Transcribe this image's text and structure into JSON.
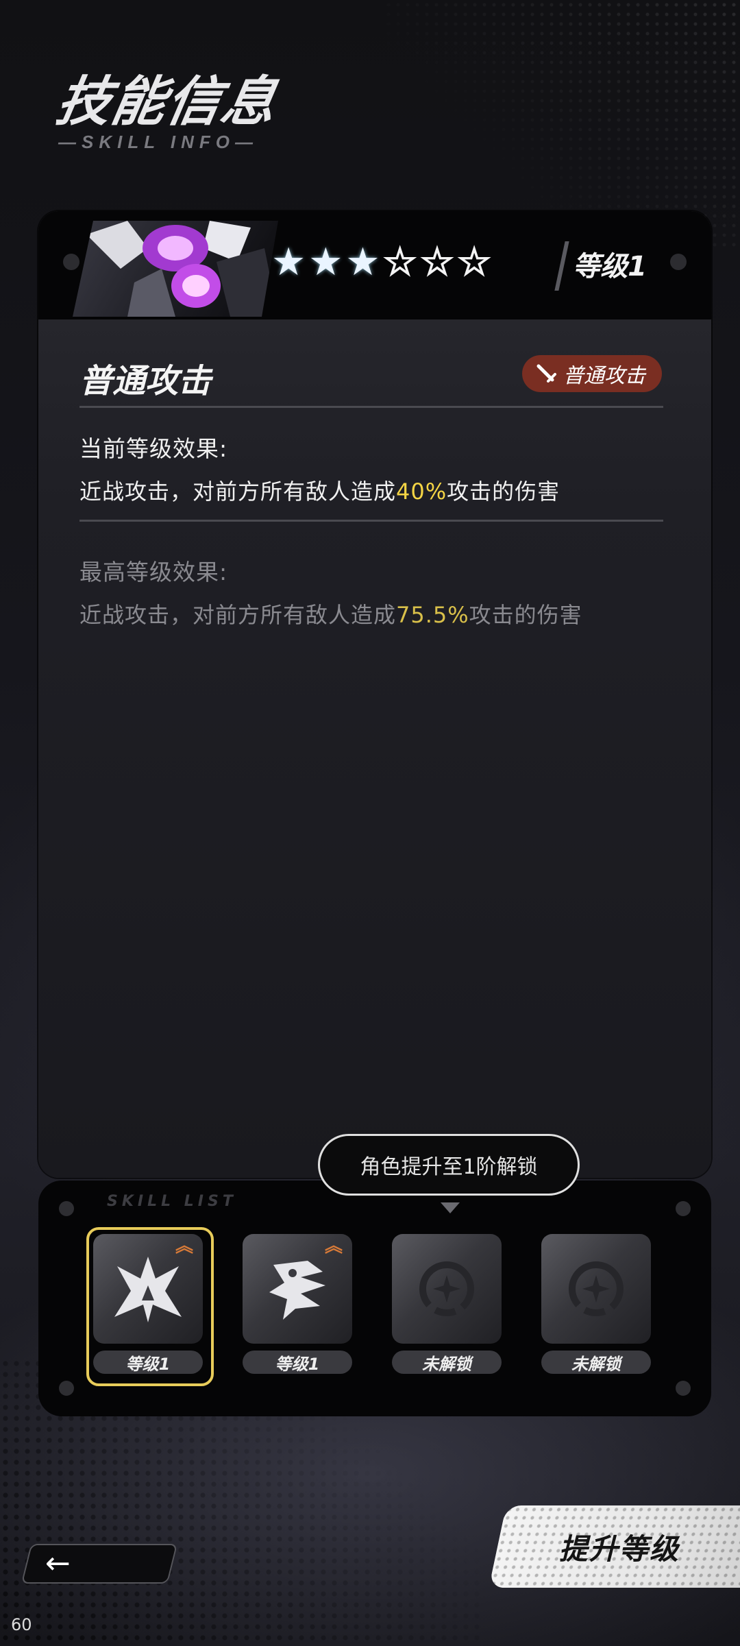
{
  "header": {
    "title": "技能信息",
    "subtitle": "—SKILL INFO—"
  },
  "skill_card": {
    "stars_filled": 3,
    "stars_total": 6,
    "level_label": "等级1",
    "skill_name": "普通攻击",
    "badge_label": "普通攻击",
    "badge_color": "#7a2e22",
    "current_effect": {
      "title": "当前等级效果:",
      "text_before": "近战攻击，对前方所有敌人造成",
      "highlight": "40%",
      "text_after": "攻击的伤害"
    },
    "max_effect": {
      "title": "最高等级效果:",
      "text_before": "近战攻击，对前方所有敌人造成",
      "highlight": "75.5%",
      "text_after": "攻击的伤害"
    }
  },
  "tooltip": "角色提升至1阶解锁",
  "skill_list": {
    "label": "SKILL LIST",
    "slots": [
      {
        "label": "等级1",
        "icon": "burst-skill-icon",
        "selected": true,
        "upgradeable": true
      },
      {
        "label": "等级1",
        "icon": "beast-skill-icon",
        "selected": false,
        "upgradeable": true
      },
      {
        "label": "未解锁",
        "icon": "locked-skill-icon",
        "selected": false,
        "upgradeable": false
      },
      {
        "label": "未解锁",
        "icon": "locked-skill-icon",
        "selected": false,
        "upgradeable": false
      }
    ]
  },
  "buttons": {
    "back_icon": "arrow-left-icon",
    "upgrade": "提升等级"
  },
  "fps": "60",
  "colors": {
    "highlight": "#f5d545",
    "selected_ring": "#e8cc5a",
    "upgrade_chevron": "#d77a38"
  }
}
